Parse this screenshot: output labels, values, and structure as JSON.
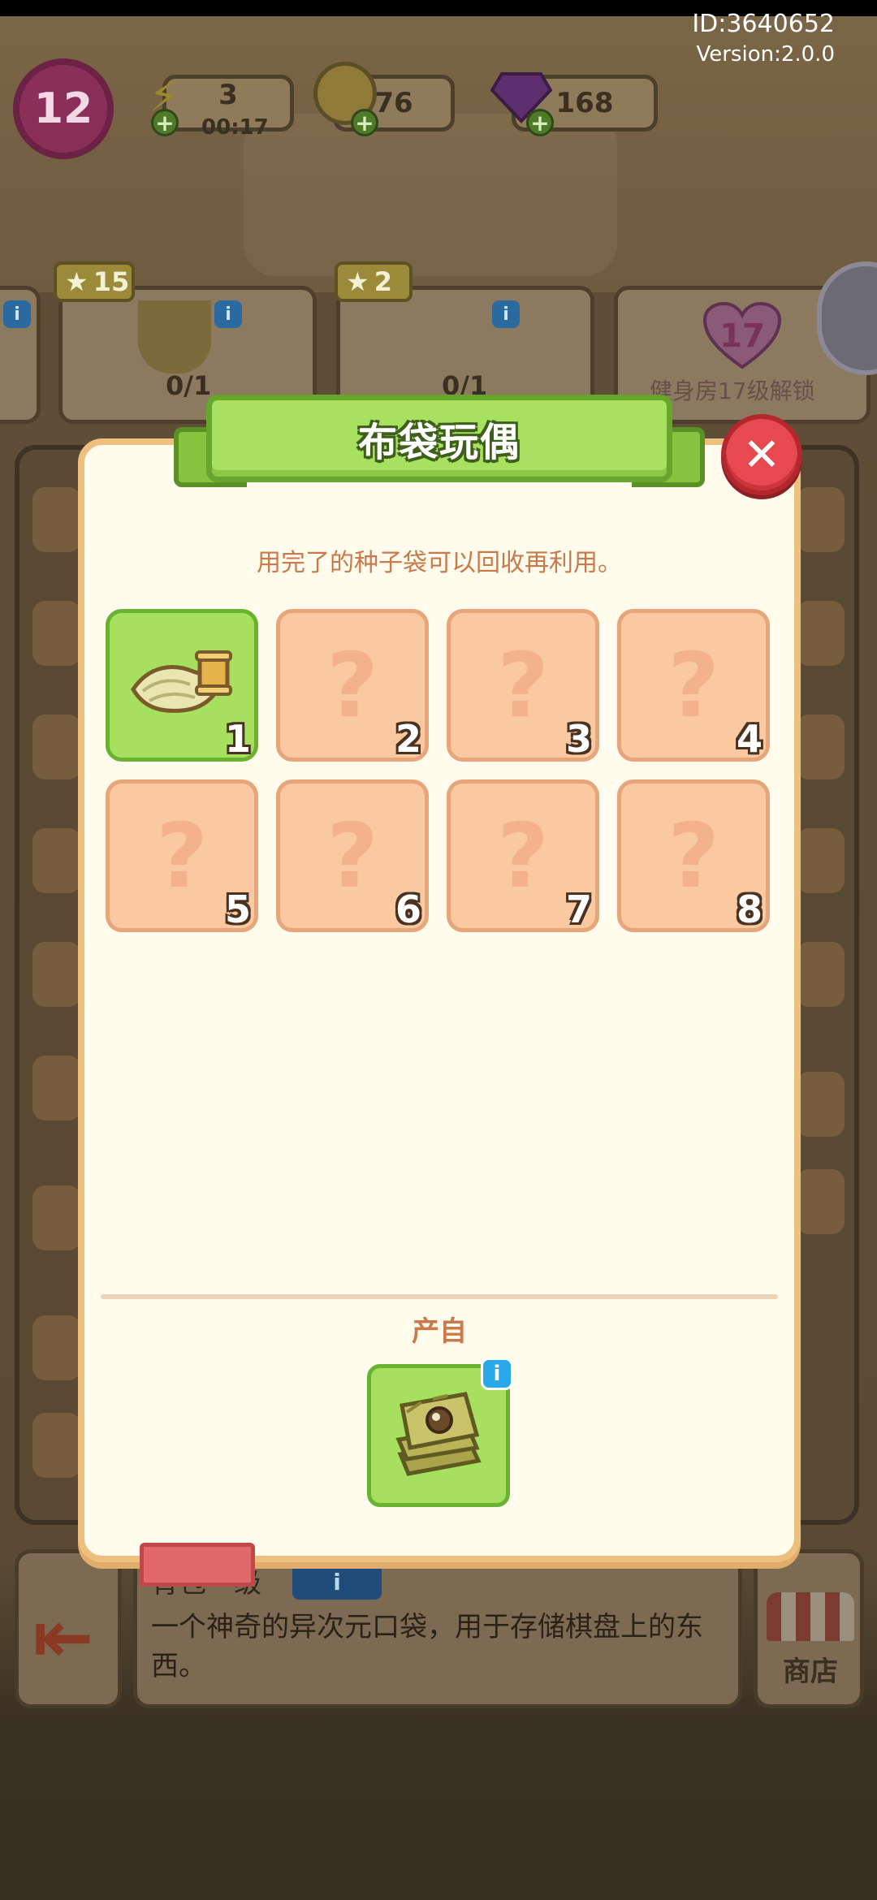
{
  "header": {
    "id_text": "ID:3640652",
    "version_text": "Version:2.0.0",
    "level": "12",
    "energy": {
      "value": "3",
      "timer": "00:17",
      "icon": "lightning-icon"
    },
    "coins": {
      "value": "76",
      "icon": "coin-icon"
    },
    "gems": {
      "value": "168",
      "icon": "gem-icon"
    }
  },
  "top_cards": [
    {
      "stars": "15",
      "count": "0/1",
      "icon": "trophy-icon"
    },
    {
      "stars": "2",
      "count": "0/1",
      "icon": "cloth-scroll-icon"
    },
    {
      "badge": "17",
      "label": "健身房17级解锁",
      "icon": "heart-badge-icon"
    }
  ],
  "bottom_bar": {
    "bag_title": "背包一级",
    "bag_desc": "一个神奇的异次元口袋，用于存储棋盘上的东西。",
    "shop_label": "商店"
  },
  "modal": {
    "title": "布袋玩偶",
    "description": "用完了的种子袋可以回收再利用。",
    "close_icon": "close-icon",
    "items": [
      {
        "number": "1",
        "state": "unlocked",
        "icon": "cloth-scroll-with-spool-icon"
      },
      {
        "number": "2",
        "state": "locked",
        "icon": "question-mark-icon"
      },
      {
        "number": "3",
        "state": "locked",
        "icon": "question-mark-icon"
      },
      {
        "number": "4",
        "state": "locked",
        "icon": "question-mark-icon"
      },
      {
        "number": "5",
        "state": "locked",
        "icon": "question-mark-icon"
      },
      {
        "number": "6",
        "state": "locked",
        "icon": "question-mark-icon"
      },
      {
        "number": "7",
        "state": "locked",
        "icon": "question-mark-icon"
      },
      {
        "number": "8",
        "state": "locked",
        "icon": "question-mark-icon"
      }
    ],
    "source_label": "产自",
    "source_item_icon": "seed-bag-stack-icon",
    "colors": {
      "unlocked": "#a6e05e",
      "locked": "#fac9a2",
      "title_banner": "#a8e060",
      "close": "#e8484f"
    }
  }
}
